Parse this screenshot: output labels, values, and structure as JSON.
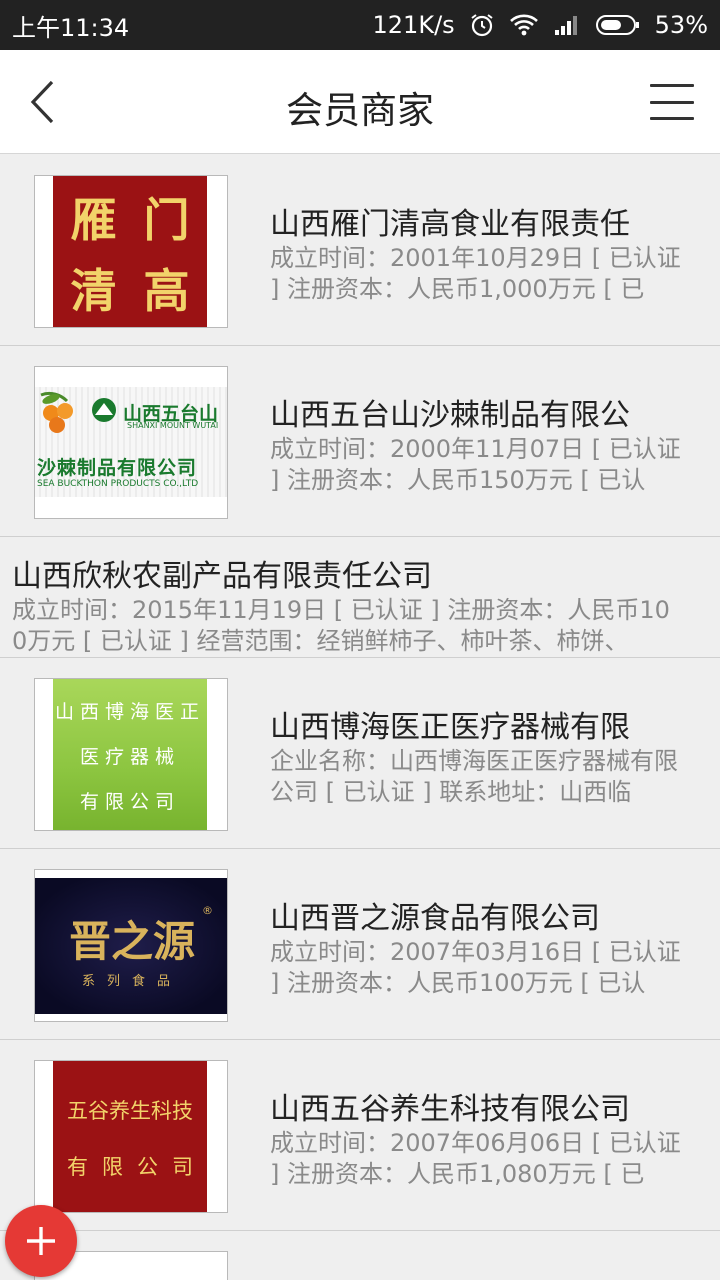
{
  "status_bar": {
    "time": "上午11:34",
    "speed": "121K/s",
    "battery": "53%"
  },
  "header": {
    "title": "会员商家"
  },
  "merchants": [
    {
      "name": "山西雁门清高食业有限责任",
      "desc": "成立时间：2001年10月29日 [ 已认证 ] 注册资本：人民币1,000万元 [ 已",
      "logo_text": [
        "雁",
        "门",
        "清",
        "高"
      ]
    },
    {
      "name": "山西五台山沙棘制品有限公",
      "desc": "成立时间：2000年11月07日 [ 已认证 ] 注册资本：人民币150万元 [ 已认",
      "logo_text": {
        "top": "山西五台山",
        "en": "SHANXI MOUNT WUTAI",
        "cn": "沙棘制品有限公司",
        "en2": "SEA BUCKTHON PRODUCTS CO.,LTD"
      }
    },
    {
      "name": "山西欣秋农副产品有限责任公司",
      "desc": "成立时间：2015年11月19日 [ 已认证 ] 注册资本：人民币100万元 [ 已认证 ] 经营范围：经销鲜柿子、柿叶茶、柿饼、"
    },
    {
      "name": "山西博海医正医疗器械有限",
      "desc": "企业名称：山西博海医正医疗器械有限公司 [ 已认证 ] 联系地址：山西临",
      "logo_text": [
        "山西博海医正",
        "医疗器械",
        "有限公司"
      ]
    },
    {
      "name": "山西晋之源食品有限公司",
      "desc": "成立时间：2007年03月16日 [ 已认证 ] 注册资本：人民币100万元 [ 已认",
      "logo_text": {
        "main": "晋之源",
        "sub": "系列食品",
        "reg": "®"
      }
    },
    {
      "name": "山西五谷养生科技有限公司",
      "desc": "成立时间：2007年06月06日 [ 已认证 ] 注册资本：人民币1,080万元 [ 已",
      "logo_text": [
        "五谷养生科技",
        "有限公司"
      ]
    }
  ],
  "colors": {
    "accent": "#e53935",
    "logo_red": "#9b1214",
    "logo_green": "#8cc540"
  },
  "icons": {
    "back": "chevron-left-icon",
    "menu": "hamburger-icon",
    "fab": "plus-icon"
  }
}
